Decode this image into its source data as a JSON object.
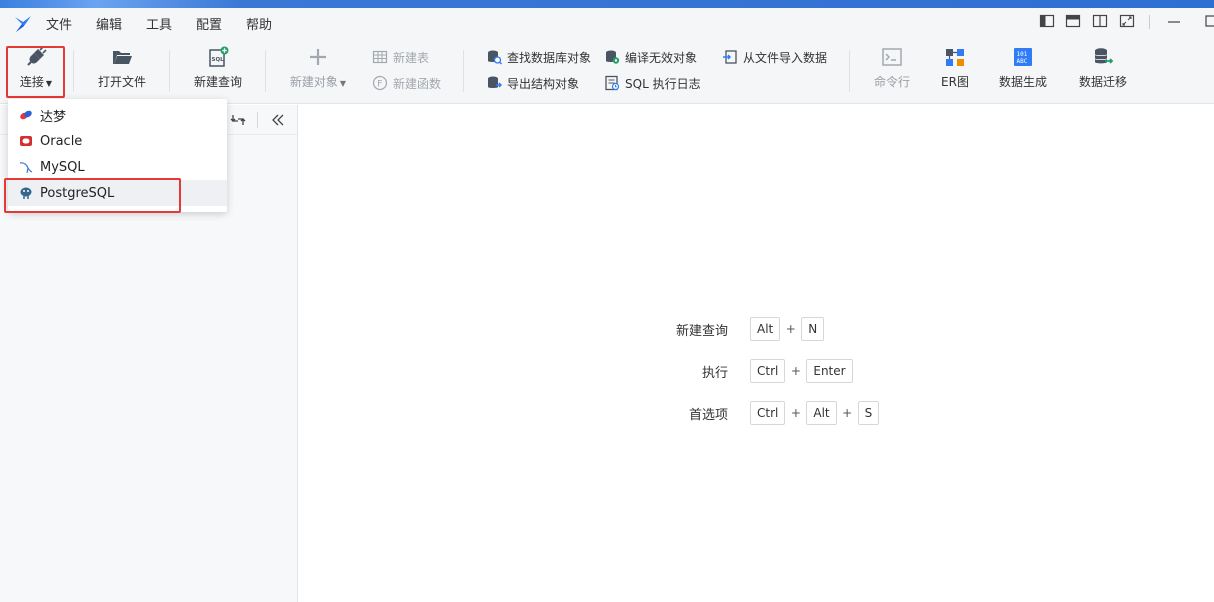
{
  "menubar": {
    "items": [
      "文件",
      "编辑",
      "工具",
      "配置",
      "帮助"
    ],
    "logo_color": "#2f7cf6"
  },
  "toolbar": {
    "connect": "连接",
    "open_file": "打开文件",
    "new_query": "新建查询",
    "new_object": "新建对象",
    "new_table": "新建表",
    "new_function": "新建函数",
    "find_db_object": "查找数据库对象",
    "compile_invalid": "编译无效对象",
    "import_from_file": "从文件导入数据",
    "export_structure": "导出结构对象",
    "sql_log": "SQL 执行日志",
    "command_line": "命令行",
    "er_diagram": "ER图",
    "data_generate": "数据生成",
    "data_migrate": "数据迁移"
  },
  "connect_menu": {
    "items": [
      {
        "label": "达梦",
        "icon": "dameng-icon"
      },
      {
        "label": "Oracle",
        "icon": "oracle-icon"
      },
      {
        "label": "MySQL",
        "icon": "mysql-icon"
      },
      {
        "label": "PostgreSQL",
        "icon": "postgresql-icon"
      }
    ],
    "selected": "PostgreSQL"
  },
  "shortcuts": [
    {
      "label": "新建查询",
      "keys": [
        "Alt",
        "N"
      ]
    },
    {
      "label": "执行",
      "keys": [
        "Ctrl",
        "Enter"
      ]
    },
    {
      "label": "首选项",
      "keys": [
        "Ctrl",
        "Alt",
        "S"
      ]
    }
  ],
  "colors": {
    "accent": "#2f7cf6",
    "highlight_border": "#e53935",
    "disabled_text": "#9aa0a6"
  }
}
